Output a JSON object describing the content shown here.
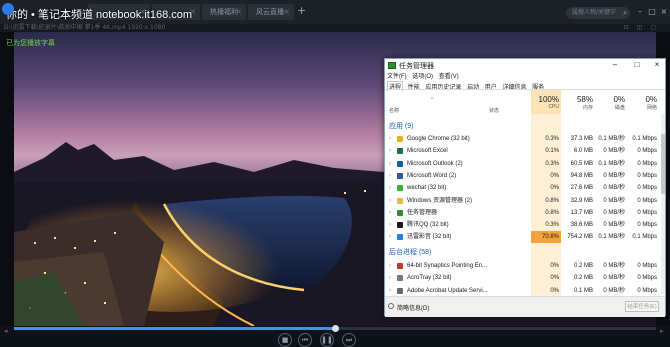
{
  "watermark": "你的 • 笔记本频道 notebook.it168.com",
  "player": {
    "tabs": [
      {
        "label": ""
      },
      {
        "label": ""
      },
      {
        "label": "热播福利"
      },
      {
        "label": "风云直播"
      }
    ],
    "search_placeholder": "猛搜人物/关键字",
    "address": "D:\\迅雷下载\\纪录片\\航拍中国 第1季 4K.mp4   1920 x 1080",
    "video_overlay": "已为您播放字幕",
    "progress": 0.5
  },
  "task_manager": {
    "title": "任务管理器",
    "menu": [
      "文件(F)",
      "选项(O)",
      "查看(V)"
    ],
    "tabs": [
      "进程",
      "性能",
      "应用历史记录",
      "启动",
      "用户",
      "详细信息",
      "服务"
    ],
    "active_tab": "进程",
    "headers": {
      "name": "名称",
      "status": "状态",
      "cpu_pct": "100%",
      "cpu": "CPU",
      "mem_pct": "58%",
      "mem": "内存",
      "disk_pct": "0%",
      "disk": "磁盘",
      "net_pct": "0%",
      "net": "网络"
    },
    "apps_group": "应用 (9)",
    "apps": [
      {
        "name": "Google Chrome (32 bit)",
        "cpu": "0.3%",
        "mem": "37.3 MB",
        "disk": "0.1 MB/秒",
        "net": "0.1 Mbps",
        "icon": "chrome-icon",
        "color": "#e0b21e"
      },
      {
        "name": "Microsoft Excel",
        "cpu": "0.1%",
        "mem": "6.0 MB",
        "disk": "0 MB/秒",
        "net": "0 Mbps",
        "icon": "excel-icon",
        "color": "#1e7145"
      },
      {
        "name": "Microsoft Outlook (2)",
        "cpu": "0.3%",
        "mem": "60.5 MB",
        "disk": "0.1 MB/秒",
        "net": "0 Mbps",
        "icon": "outlook-icon",
        "color": "#0f5fa8"
      },
      {
        "name": "Microsoft Word (2)",
        "cpu": "0%",
        "mem": "94.8 MB",
        "disk": "0 MB/秒",
        "net": "0 Mbps",
        "icon": "word-icon",
        "color": "#2b5797"
      },
      {
        "name": "wechat (32 bit)",
        "cpu": "0%",
        "mem": "27.6 MB",
        "disk": "0 MB/秒",
        "net": "0 Mbps",
        "icon": "wechat-icon",
        "color": "#3cb034"
      },
      {
        "name": "Windows 资源管理器 (2)",
        "cpu": "0.8%",
        "mem": "32.9 MB",
        "disk": "0 MB/秒",
        "net": "0 Mbps",
        "icon": "explorer-icon",
        "color": "#e8b84a"
      },
      {
        "name": "任务管理器",
        "cpu": "0.8%",
        "mem": "13.7 MB",
        "disk": "0 MB/秒",
        "net": "0 Mbps",
        "icon": "taskmgr-icon",
        "color": "#2f8f2f"
      },
      {
        "name": "腾讯QQ (32 bit)",
        "cpu": "0.3%",
        "mem": "38.6 MB",
        "disk": "0 MB/秒",
        "net": "0 Mbps",
        "icon": "qq-icon",
        "color": "#1a1a1a"
      },
      {
        "name": "迅雷影音 (32 bit)",
        "cpu": "70.8%",
        "mem": "754.2 MB",
        "disk": "0.1 MB/秒",
        "net": "0.1 Mbps",
        "icon": "xunlei-icon",
        "color": "#2a7de1"
      }
    ],
    "bg_group": "后台进程 (58)",
    "bg": [
      {
        "name": "64-bit Synaptics Pointing En...",
        "cpu": "0%",
        "mem": "0.2 MB",
        "disk": "0 MB/秒",
        "net": "0 Mbps",
        "icon": "synaptics-icon",
        "color": "#c0392b"
      },
      {
        "name": "AcroTray (32 bit)",
        "cpu": "0%",
        "mem": "0.2 MB",
        "disk": "0 MB/秒",
        "net": "0 Mbps",
        "icon": "acrotray-icon",
        "color": "#7a7a7a"
      },
      {
        "name": "Adobe Acrobat Update Servi...",
        "cpu": "0%",
        "mem": "0.1 MB",
        "disk": "0 MB/秒",
        "net": "0 Mbps",
        "icon": "adobe-icon",
        "color": "#6a6a6a"
      }
    ],
    "footer_label": "简略信息(D)",
    "end_task": "结束任务(E)"
  }
}
